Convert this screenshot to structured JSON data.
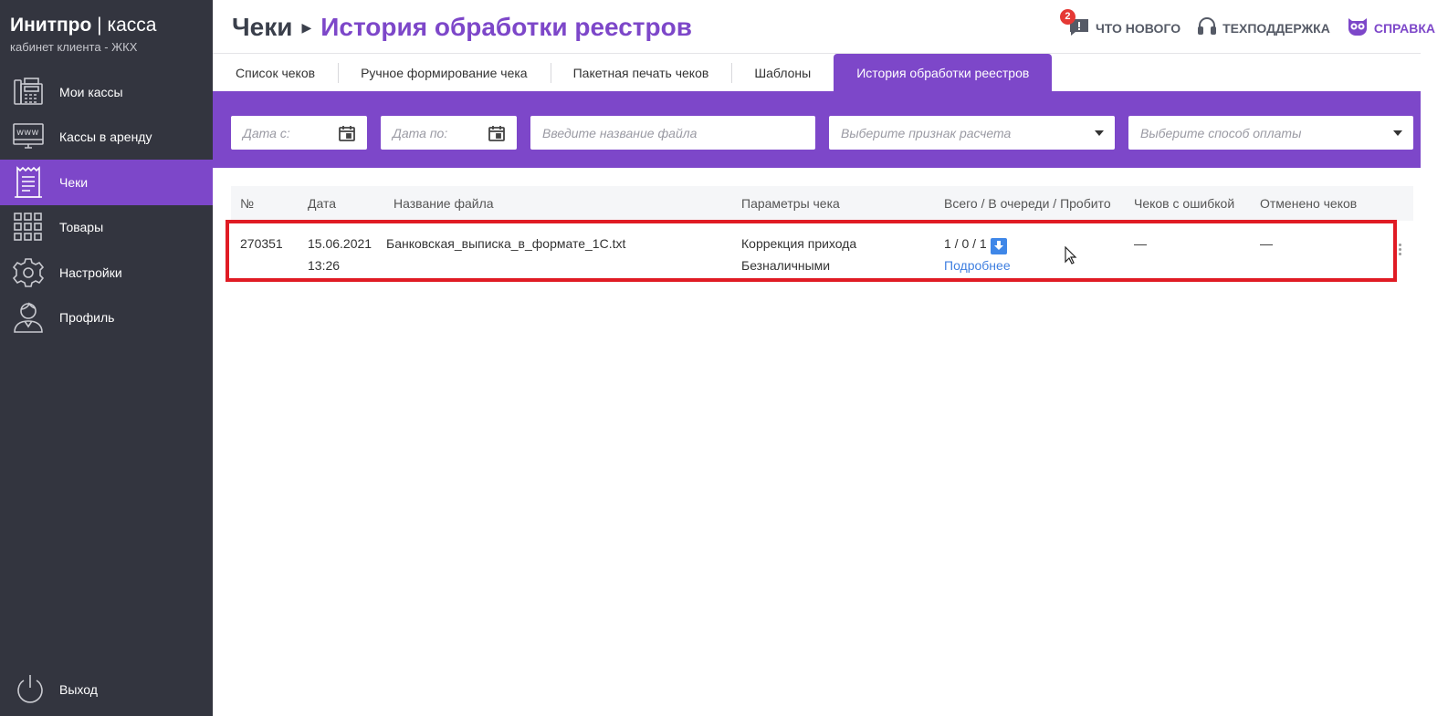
{
  "brand": {
    "name": "Инитпро",
    "product": "касса",
    "subtitle": "кабинет клиента - ЖКХ"
  },
  "sidebar": {
    "items": [
      {
        "label": "Мои кассы",
        "icon": "cash-register-icon"
      },
      {
        "label": "Кассы в аренду",
        "icon": "www-monitor-icon"
      },
      {
        "label": "Чеки",
        "icon": "receipt-icon",
        "active": true
      },
      {
        "label": "Товары",
        "icon": "grid-icon"
      },
      {
        "label": "Настройки",
        "icon": "gear-icon"
      },
      {
        "label": "Профиль",
        "icon": "user-icon"
      }
    ],
    "logout_label": "Выход"
  },
  "header": {
    "breadcrumb_root": "Чеки",
    "breadcrumb_current": "История обработки реестров",
    "whats_new": "Что нового",
    "whats_new_badge": "2",
    "support": "Техподдержка",
    "help": "Справка"
  },
  "tabs": [
    {
      "label": "Список чеков"
    },
    {
      "label": "Ручное формирование чека"
    },
    {
      "label": "Пакетная печать чеков"
    },
    {
      "label": "Шаблоны"
    },
    {
      "label": "История обработки реестров",
      "active": true
    }
  ],
  "filters": {
    "date_from_placeholder": "Дата с:",
    "date_to_placeholder": "Дата по:",
    "filename_placeholder": "Введите название файла",
    "payment_sign_placeholder": "Выберите признак расчета",
    "payment_method_placeholder": "Выберите способ оплаты"
  },
  "table": {
    "columns": [
      "№",
      "Дата",
      "Название файла",
      "Параметры чека",
      "Всего / В очереди / Пробито",
      "Чеков с ошибкой",
      "Отменено чеков"
    ],
    "rows": [
      {
        "number": "270351",
        "date": "15.06.2021",
        "time": "13:26",
        "filename": "Банковская_выписка_в_формате_1C.txt",
        "param_type": "Коррекция прихода",
        "param_payment": "Безналичными",
        "counts": "1 / 0 / 1",
        "details_link": "Подробнее",
        "errors": "—",
        "cancelled": "—"
      }
    ]
  },
  "colors": {
    "accent": "#7d47c9",
    "sidebar_bg": "#33353f",
    "highlight": "#e01b24",
    "link": "#3f7fe0"
  }
}
